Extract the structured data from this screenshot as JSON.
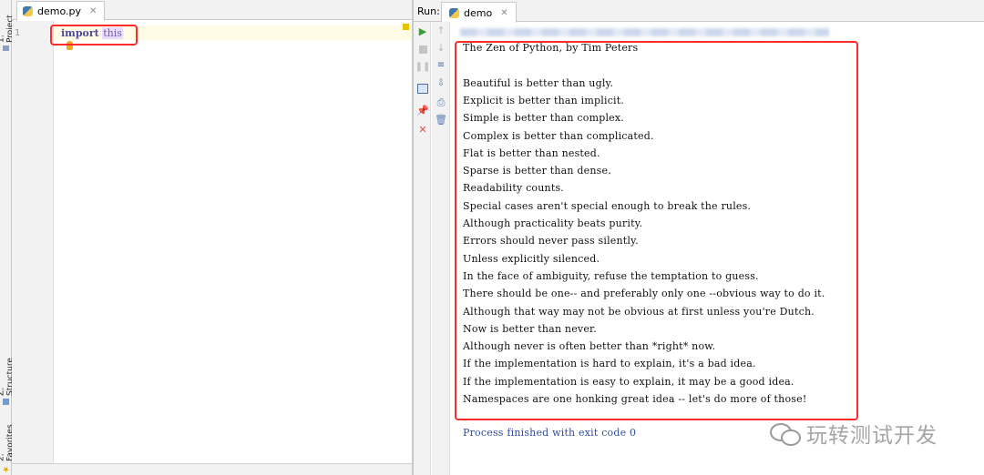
{
  "left_stripe": {
    "project_tab": "1: Project",
    "structure_tab": "Z: Structure",
    "favorites_tab": "2: Favorites"
  },
  "editor": {
    "tab_label": "demo.py",
    "line_number": "1",
    "code_keyword": "import",
    "code_module": "this"
  },
  "run": {
    "label": "Run:",
    "tab_label": "demo",
    "output_lines": [
      "The Zen of Python, by Tim Peters",
      "",
      "Beautiful is better than ugly.",
      "Explicit is better than implicit.",
      "Simple is better than complex.",
      "Complex is better than complicated.",
      "Flat is better than nested.",
      "Sparse is better than dense.",
      "Readability counts.",
      "Special cases aren't special enough to break the rules.",
      "Although practicality beats purity.",
      "Errors should never pass silently.",
      "Unless explicitly silenced.",
      "In the face of ambiguity, refuse the temptation to guess.",
      "There should be one-- and preferably only one --obvious way to do it.",
      "Although that way may not be obvious at first unless you're Dutch.",
      "Now is better than never.",
      "Although never is often better than *right* now.",
      "If the implementation is hard to explain, it's a bad idea.",
      "If the implementation is easy to explain, it may be a good idea.",
      "Namespaces are one honking great idea -- let's do more of those!"
    ],
    "exit_message": "Process finished with exit code 0"
  },
  "watermark": {
    "text": "玩转测试开发"
  },
  "colors": {
    "highlight_box": "#ff2a2a",
    "run_green": "#3c9a3c",
    "stop_red": "#d9534f"
  }
}
